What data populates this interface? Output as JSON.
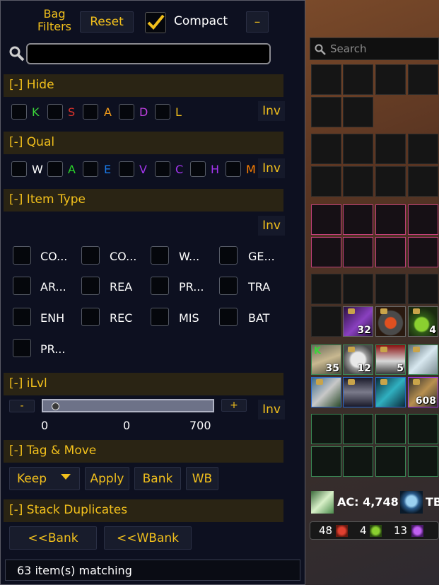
{
  "filters": {
    "title_line1": "Bag",
    "title_line2": "Filters",
    "reset_label": "Reset",
    "compact_label": "Compact",
    "compact_checked": true,
    "collapse_label": "–",
    "search_value": "",
    "sections": {
      "hide": "[-] Hide",
      "qual": "[-] Qual",
      "item_type": "[-] Item Type",
      "ilvl": "[-] iLvl",
      "tag_move": "[-] Tag & Move",
      "stack": "[-] Stack Duplicates"
    },
    "inv_label": "Inv",
    "hide_options": [
      {
        "label": "K",
        "color": "#3ad43a"
      },
      {
        "label": "S",
        "color": "#e0342c"
      },
      {
        "label": "A",
        "color": "#f09a1a"
      },
      {
        "label": "D",
        "color": "#c040e0"
      },
      {
        "label": "L",
        "color": "#f2c01c"
      }
    ],
    "qual_options": [
      {
        "label": "W",
        "color": "#ffffff"
      },
      {
        "label": "A",
        "color": "#2ad42a"
      },
      {
        "label": "E",
        "color": "#1a7ae8"
      },
      {
        "label": "V",
        "color": "#a335ee"
      },
      {
        "label": "C",
        "color": "#a335ee"
      },
      {
        "label": "H",
        "color": "#a335ee"
      },
      {
        "label": "M",
        "color": "#ff8000"
      }
    ],
    "item_types": [
      "CO...",
      "CO...",
      "W...",
      "GE...",
      "AR...",
      "REA",
      "PR...",
      "TRA",
      "ENH",
      "REC",
      "MIS",
      "BAT",
      "PR..."
    ],
    "ilvl": {
      "minus": "-",
      "plus": "+",
      "min": "0",
      "mid": "0",
      "max": "700"
    },
    "tag_move": {
      "keep": "Keep",
      "apply": "Apply",
      "bank": "Bank",
      "wb": "WB"
    },
    "stack": {
      "to_bank": "<<Bank",
      "to_wbank": "<<WBank"
    },
    "status": "63 item(s) matching"
  },
  "bag": {
    "search_placeholder": "Search",
    "counts": {
      "r6c1": "32",
      "r6c3": "4",
      "r7c0": "35",
      "r7c1": "12",
      "r7c2": "5",
      "r8c3": "608"
    },
    "ac_label": "AC: 4,748",
    "tb_label": "TB",
    "currency": [
      "48",
      "4",
      "13"
    ]
  }
}
